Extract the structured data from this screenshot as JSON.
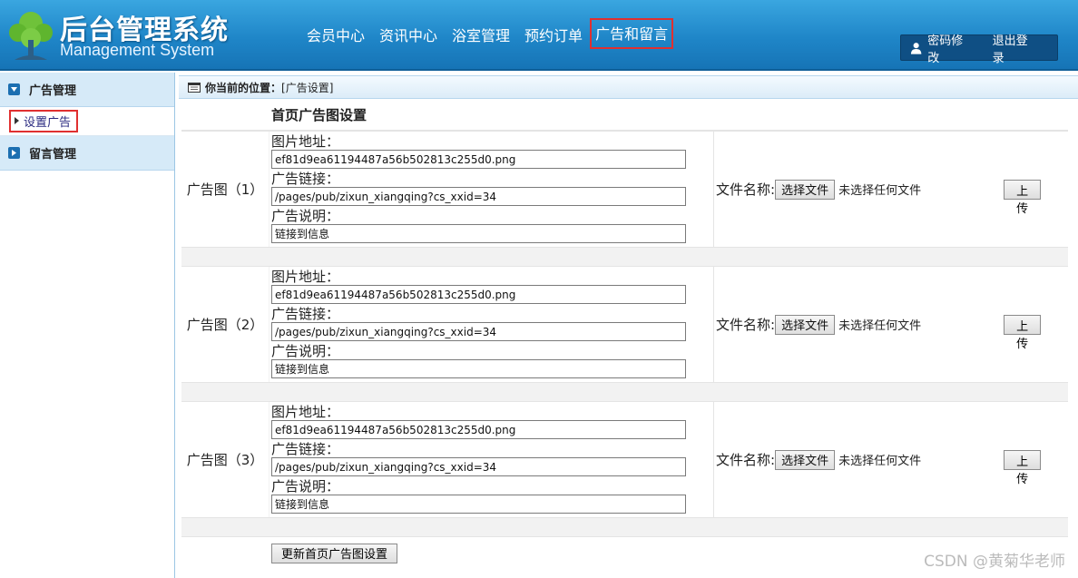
{
  "header": {
    "title": "后台管理系统",
    "subtitle": "Management System",
    "nav": [
      "会员中心",
      "资讯中心",
      "浴室管理",
      "预约订单",
      "广告和留言"
    ],
    "active_nav": 4,
    "user_links": [
      "密码修改",
      "退出登录"
    ]
  },
  "sidebar": {
    "groups": [
      {
        "label": "广告管理",
        "items": [
          "设置广告"
        ]
      },
      {
        "label": "留言管理",
        "items": []
      }
    ]
  },
  "breadcrumb": {
    "prefix": "你当前的位置：",
    "current": "[广告设置]"
  },
  "form": {
    "title": "首页广告图设置",
    "fields": {
      "image_label": "图片地址：",
      "link_label": "广告链接：",
      "desc_label": "广告说明："
    },
    "file_label": "文件名称:",
    "choose_file": "选择文件",
    "no_file": "未选择任何文件",
    "upload": "上 传",
    "submit": "更新首页广告图设置",
    "ads": [
      {
        "label": "广告图（1）",
        "image": "ef81d9ea61194487a56b502813c255d0.png",
        "link": "/pages/pub/zixun_xiangqing?cs_xxid=34",
        "desc": "链接到信息"
      },
      {
        "label": "广告图（2）",
        "image": "ef81d9ea61194487a56b502813c255d0.png",
        "link": "/pages/pub/zixun_xiangqing?cs_xxid=34",
        "desc": "链接到信息"
      },
      {
        "label": "广告图（3）",
        "image": "ef81d9ea61194487a56b502813c255d0.png",
        "link": "/pages/pub/zixun_xiangqing?cs_xxid=34",
        "desc": "链接到信息"
      }
    ]
  },
  "watermark": "CSDN @黄菊华老师",
  "colors": {
    "header": "#1f86c8",
    "highlight": "#e03030",
    "sidebar_group": "#d6eaf8"
  }
}
